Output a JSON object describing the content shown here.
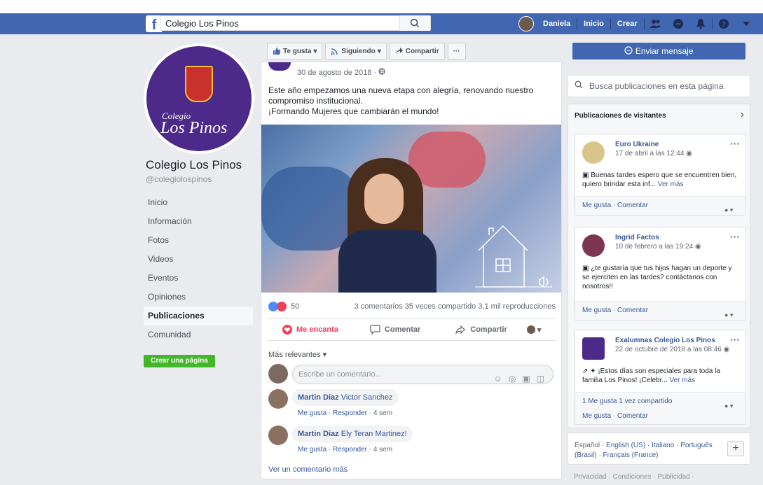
{
  "topbar": {
    "search_value": "Colegio Los Pinos",
    "user_name": "Daniela",
    "nav": [
      "Inicio",
      "Crear"
    ]
  },
  "page": {
    "logo_line1": "Colegio",
    "logo_line2": "Los Pinos",
    "name": "Colegio Los Pinos",
    "handle": "@colegiolospinos",
    "nav": [
      {
        "label": "Inicio",
        "active": false
      },
      {
        "label": "Información",
        "active": false
      },
      {
        "label": "Fotos",
        "active": false
      },
      {
        "label": "Videos",
        "active": false
      },
      {
        "label": "Eventos",
        "active": false
      },
      {
        "label": "Opiniones",
        "active": false
      },
      {
        "label": "Publicaciones",
        "active": true
      },
      {
        "label": "Comunidad",
        "active": false
      }
    ],
    "create_page": "Crear una página"
  },
  "action_bar": {
    "like": "Te gusta",
    "follow": "Siguiendo",
    "share": "Compartir",
    "more": "···"
  },
  "post": {
    "date": "30 de agosto de 2018 ·",
    "text_line1": "Este año empezamos una nueva etapa con alegría, renovando nuestro compromiso institucional.",
    "text_line2": "¡Formando Mujeres que cambiarán el mundo!",
    "reactions_count": "50",
    "stats": "3 comentarios  35 veces compartido  3,1 mil reproducciones",
    "action_love": "Me encanta",
    "action_comment": "Comentar",
    "action_share": "Compartir",
    "comments_filter": "Más relevantes ▾",
    "comment_placeholder": "Escribe un comentario...",
    "comments": [
      {
        "author": "Martin Diaz",
        "tag": "Victor Sanchez",
        "meta_like": "Me gusta",
        "meta_reply": "Responder",
        "meta_time": "4 sem"
      },
      {
        "author": "Martin Diaz",
        "tag": "Ely Teran Martinez!",
        "meta_like": "Me gusta",
        "meta_reply": "Responder",
        "meta_time": "4 sem"
      }
    ],
    "more_comments": "Ver un comentario más"
  },
  "right": {
    "send_message": "Enviar mensaje",
    "search_placeholder": "Busca publicaciones en esta página",
    "visitors_title": "Publicaciones de visitantes",
    "visitor_posts": [
      {
        "name": "Euro Ukraine",
        "date": "17 de abril a las 12:44",
        "text": "Buenas tardes espero que se encuentren bien, quiero brindar esta inf...",
        "more": "Ver más",
        "footer_like": "Me gusta",
        "footer_comment": "Comentar",
        "footer_stats": ""
      },
      {
        "name": "Ingrid Factos",
        "date": "10 de febrero a las 19:24",
        "text": "¿te gustaría que tus hijos hagan un deporte y se ejerciten en las tardes? contáctanos con nosotros!!",
        "more": "",
        "footer_like": "Me gusta",
        "footer_comment": "Comentar",
        "footer_stats": ""
      },
      {
        "name": "Exalumnas Colegio Los Pinos",
        "date": "22 de octubre de 2018 a las 08:46",
        "text": "¡Estos días son especiales para toda la familia Los Pinos! ¡Celebr...",
        "more": "Ver más",
        "footer_like": "Me gusta",
        "footer_comment": "Comentar",
        "footer_stats": "1 Me gusta   1 vez compartido"
      }
    ],
    "languages_current": "Español ·",
    "languages_rest": " English (US) · Italiano · Português (Brasil) · Français (France)",
    "footer": "Privacidad · Condiciones · Publicidad ·"
  },
  "colors": {
    "brand": "#4267b2",
    "link": "#385898",
    "green": "#42b72a",
    "love": "#f33e58"
  }
}
